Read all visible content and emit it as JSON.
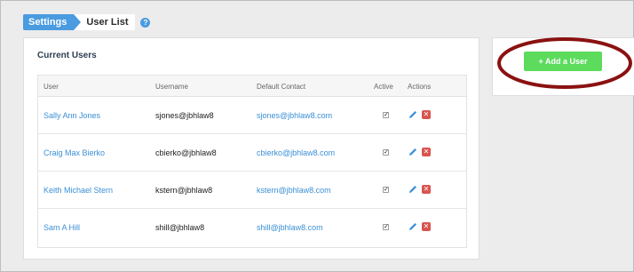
{
  "breadcrumb": {
    "settings": "Settings",
    "current": "User List",
    "help": "?"
  },
  "users_panel": {
    "title": "Current Users",
    "columns": [
      "User",
      "Username",
      "Default Contact",
      "Active",
      "Actions"
    ],
    "rows": [
      {
        "user": "Sally Ann Jones",
        "username": "sjones@jbhlaw8",
        "contact": "sjones@jbhlaw8.com",
        "active": true
      },
      {
        "user": "Craig Max Bierko",
        "username": "cbierko@jbhlaw8",
        "contact": "cbierko@jbhlaw8.com",
        "active": true
      },
      {
        "user": "Keith Michael Stern",
        "username": "kstern@jbhlaw8",
        "contact": "kstern@jbhlaw8.com",
        "active": true
      },
      {
        "user": "Sam A Hill",
        "username": "shill@jbhlaw8",
        "contact": "shill@jbhlaw8.com",
        "active": true
      }
    ]
  },
  "add_panel": {
    "button_label": "+ Add a User"
  },
  "colors": {
    "accent": "#4a9be0",
    "add_button": "#5cdb5c",
    "delete": "#d9534f",
    "highlight": "#8b1111"
  },
  "icons": {
    "edit": "pencil-icon",
    "delete": "delete-icon",
    "help": "help-icon",
    "check": "checkmark-icon"
  }
}
